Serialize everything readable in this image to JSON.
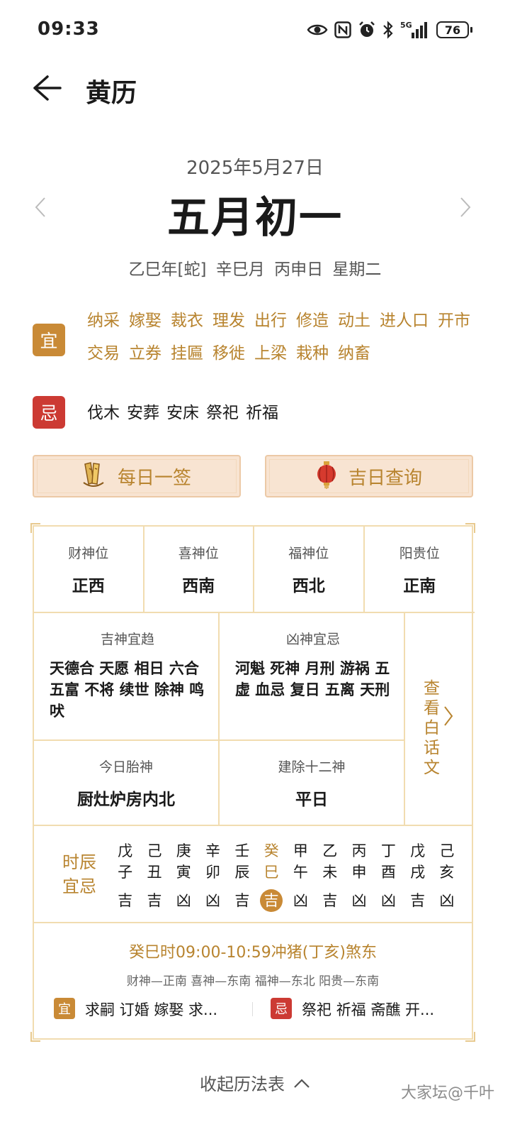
{
  "status_bar": {
    "time": "09:33",
    "icons": [
      "eye-icon",
      "nfc-icon",
      "alarm-icon",
      "bluetooth-icon",
      "5g-signal-icon"
    ],
    "battery": "76"
  },
  "header": {
    "title": "黄历",
    "back_icon": "arrow-left-icon"
  },
  "date": {
    "solar": "2025年5月27日",
    "lunar": "五月初一",
    "ganzhi": "乙巳年[蛇] 辛巳月 丙申日 星期二"
  },
  "yi": {
    "badge": "宜",
    "items": [
      "纳采",
      "嫁娶",
      "裁衣",
      "理发",
      "出行",
      "修造",
      "动土",
      "进人口",
      "开市",
      "交易",
      "立券",
      "挂匾",
      "移徙",
      "上梁",
      "栽种",
      "纳畜"
    ]
  },
  "ji": {
    "badge": "忌",
    "items": [
      "伐木",
      "安葬",
      "安床",
      "祭祀",
      "祈福"
    ]
  },
  "actions": {
    "daily_sign": "每日一签",
    "lucky_day": "吉日查询"
  },
  "gods": [
    {
      "label": "财神位",
      "value": "正西"
    },
    {
      "label": "喜神位",
      "value": "西南"
    },
    {
      "label": "福神位",
      "value": "西北"
    },
    {
      "label": "阳贵位",
      "value": "正南"
    }
  ],
  "auspicious_gods": {
    "label": "吉神宜趋",
    "text": "天德合 天愿 相日 六合 五富 不将 续世 除神 鸣吠"
  },
  "inauspicious_gods": {
    "label": "凶神宜忌",
    "text": "河魁 死神 月刑 游祸 五虚 血忌 复日 五离 天刑"
  },
  "fetal_god": {
    "label": "今日胎神",
    "value": "厨灶炉房内北"
  },
  "twelve_gods": {
    "label": "建除十二神",
    "value": "平日"
  },
  "vernacular_link": "查看白话文",
  "shichen": {
    "title": "时辰宜忌",
    "hours": [
      {
        "gan": "戊",
        "zhi": "子",
        "luck": "吉"
      },
      {
        "gan": "己",
        "zhi": "丑",
        "luck": "吉"
      },
      {
        "gan": "庚",
        "zhi": "寅",
        "luck": "凶"
      },
      {
        "gan": "辛",
        "zhi": "卯",
        "luck": "凶"
      },
      {
        "gan": "壬",
        "zhi": "辰",
        "luck": "吉"
      },
      {
        "gan": "癸",
        "zhi": "巳",
        "luck": "吉"
      },
      {
        "gan": "甲",
        "zhi": "午",
        "luck": "凶"
      },
      {
        "gan": "乙",
        "zhi": "未",
        "luck": "吉"
      },
      {
        "gan": "丙",
        "zhi": "申",
        "luck": "凶"
      },
      {
        "gan": "丁",
        "zhi": "酉",
        "luck": "凶"
      },
      {
        "gan": "戊",
        "zhi": "戌",
        "luck": "吉"
      },
      {
        "gan": "己",
        "zhi": "亥",
        "luck": "凶"
      }
    ],
    "current_index": 5,
    "detail_head": "癸巳时09:00-10:59冲猪(丁亥)煞东",
    "detail_gods": "财神—正南 喜神—东南 福神—东北 阳贵—东南",
    "yi_badge": "宜",
    "yi_text": "求嗣 订婚 嫁娶 求...",
    "ji_badge": "忌",
    "ji_text": "祭祀 祈福 斋醮 开..."
  },
  "footer": {
    "collapse": "收起历法表",
    "watermark": "大家坛@千叶"
  },
  "colors": {
    "gold": "#b8842f",
    "yi_badge": "#c98a36",
    "ji_badge": "#cc3a33",
    "button_bg": "#f8e4d2",
    "table_border": "#f1dcb0"
  }
}
